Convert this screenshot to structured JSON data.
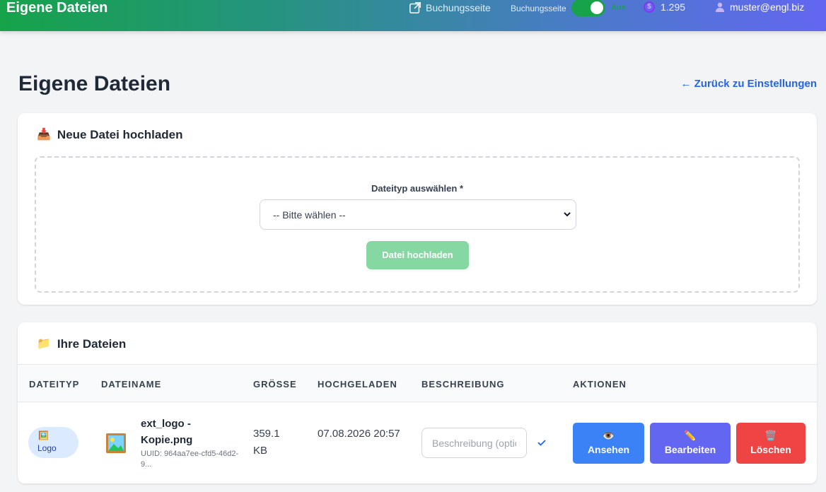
{
  "header": {
    "brand": "Eigene Dateien",
    "booking_link": "Buchungsseite",
    "toggle_label": "Buchungsseite",
    "toggle_state": "Aus",
    "credits": "1.295",
    "user_email": "muster@engl.biz",
    "accent_colors": [
      "#16a34a",
      "#6366f1"
    ]
  },
  "page": {
    "title": "Eigene Dateien",
    "back_link": "← Zurück zu Einstellungen"
  },
  "upload": {
    "title": "Neue Datei hochladen",
    "icon": "inbox-tray-icon",
    "filetype_label": "Dateityp auswählen *",
    "select_value": "-- Bitte wählen --",
    "upload_button": "Datei hochladen"
  },
  "files": {
    "title": "Ihre Dateien",
    "icon": "folder-icon",
    "columns": [
      "DATEITYP",
      "DATEINAME",
      "GRÖSSE",
      "HOCHGELADEN",
      "BESCHREIBUNG",
      "AKTIONEN"
    ],
    "rows": [
      {
        "type": "Logo",
        "name": "ext_logo - Kopie.png",
        "uuid": "UUID: 964aa7ee-cfd5-46d2-9...",
        "size": "359.1 KB",
        "uploaded": "07.08.2026 20:57",
        "description_placeholder": "Beschreibung (optional)",
        "actions": {
          "view": "Ansehen",
          "edit": "Bearbeiten",
          "delete": "Löschen"
        }
      }
    ]
  }
}
